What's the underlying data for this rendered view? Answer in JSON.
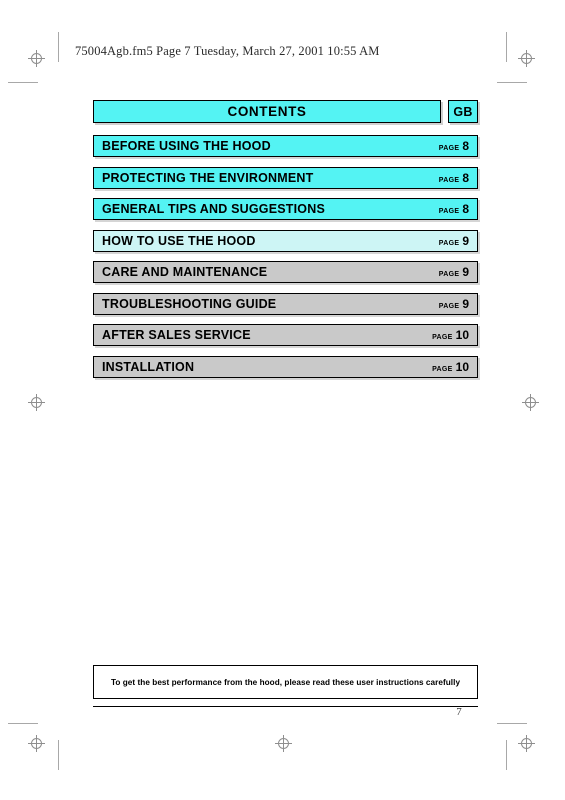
{
  "document": {
    "running_head": "75004Agb.fm5  Page 7  Tuesday, March 27, 2001  10:55 AM",
    "page_number": "7"
  },
  "contents": {
    "title": "CONTENTS",
    "language_badge": "GB",
    "page_word": "PAGE",
    "items": [
      {
        "label": "BEFORE USING THE HOOD",
        "page_word": "PAGE",
        "page": "8",
        "color": "#54f3f3"
      },
      {
        "label": "PROTECTING THE ENVIRONMENT",
        "page_word": "PAGE",
        "page": "8",
        "color": "#54f3f3"
      },
      {
        "label": "GENERAL TIPS AND SUGGESTIONS",
        "page_word": "PAGE",
        "page": "8",
        "color": "#54f3f3"
      },
      {
        "label": "HOW TO USE THE HOOD",
        "page_word": "PAGE",
        "page": "9",
        "color": "#cdf5f5"
      },
      {
        "label": "CARE AND MAINTENANCE",
        "page_word": "PAGE",
        "page": "9",
        "color": "#c9c9c9"
      },
      {
        "label": "TROUBLESHOOTING GUIDE",
        "page_word": "PAGE",
        "page": "9",
        "color": "#c9c9c9"
      },
      {
        "label": "AFTER SALES SERVICE",
        "page_word": "PAGE",
        "page": "10",
        "color": "#c9c9c9"
      },
      {
        "label": "INSTALLATION",
        "page_word": "PAGE",
        "page": "10",
        "color": "#c9c9c9"
      }
    ]
  },
  "footer": {
    "note": "To get the best performance from the hood, please read these user instructions carefully"
  },
  "colors": {
    "accent_cyan": "#54f3f3",
    "pale_cyan": "#cdf5f5",
    "grey": "#c9c9c9",
    "ink": "#000000"
  }
}
